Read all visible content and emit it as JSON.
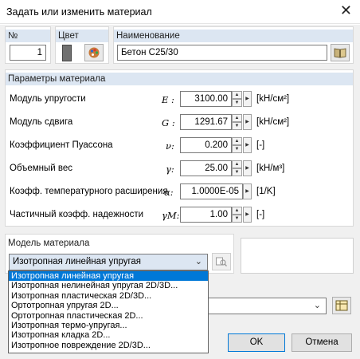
{
  "window": {
    "title": "Задать или изменить материал",
    "close_glyph": "✕"
  },
  "id_group": {
    "header": "№",
    "value": "1"
  },
  "color_group": {
    "header": "Цвет",
    "swatch_color": "#707070"
  },
  "name_group": {
    "header": "Наименование",
    "value": "Бетон C25/30",
    "library_icon": "book-icon"
  },
  "params": {
    "header": "Параметры материала",
    "rows": [
      {
        "label": "Модуль упругости",
        "symbol": "E :",
        "value": "3100.00",
        "unit": "[kH/см²]"
      },
      {
        "label": "Модуль сдвига",
        "symbol": "G :",
        "value": "1291.67",
        "unit": "[kH/см²]"
      },
      {
        "label": "Коэффициент Пуассона",
        "symbol": "ν:",
        "value": "0.200",
        "unit": "[-]"
      },
      {
        "label": "Объемный вес",
        "symbol": "γ:",
        "value": "25.00",
        "unit": "[kH/м³]"
      },
      {
        "label": "Коэфф. температурного расширения",
        "symbol": "α:",
        "value": "1.0000E-05",
        "unit": "[1/K]"
      },
      {
        "label": "Частичный коэфф. надежности",
        "symbol": "γM:",
        "value": "1.00",
        "unit": "[-]"
      }
    ]
  },
  "model": {
    "header": "Модель материала",
    "selected": "Изотропная линейная упругая",
    "options": [
      "Изотропная линейная упругая",
      "Изотропная нелинейная упругая 2D/3D...",
      "Изотропная пластическая 2D/3D...",
      "Ортотропная упругая 2D...",
      "Ортотропная пластическая 2D...",
      "Изотропная термо-упругая...",
      "Изотропная кладка 2D...",
      "Изотропное повреждение 2D/3D..."
    ]
  },
  "buttons": {
    "ok": "OK",
    "cancel": "Отмена"
  },
  "colors": {
    "header_bg": "#dce6f2",
    "selection": "#0078d7",
    "default_border": "#0078d7"
  }
}
